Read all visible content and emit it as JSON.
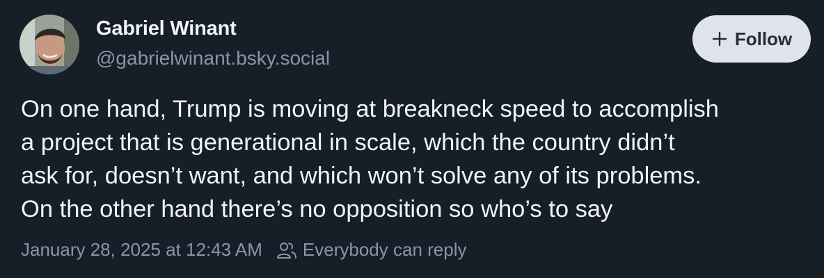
{
  "author": {
    "display_name": "Gabriel Winant",
    "handle": "@gabrielwinant.bsky.social",
    "avatar_icon": "profile-photo"
  },
  "follow_button": {
    "icon": "plus-icon",
    "label": "Follow"
  },
  "post": {
    "text_lines": [
      "On one hand, Trump is moving at breakneck speed to accomplish",
      "a project that is generational in scale, which the country didn’t",
      "ask for, doesn’t want, and which won’t solve any of its problems.",
      "On the other hand there’s no opposition so who’s to say"
    ]
  },
  "meta": {
    "timestamp": "January 28, 2025 at 12:43 AM",
    "reply_icon": "people-icon",
    "reply_setting": "Everybody can reply"
  },
  "colors": {
    "background": "#161e27",
    "primary_text": "#f1f3f5",
    "secondary_text": "#8596aa",
    "follow_button_bg": "#dfe4ea"
  }
}
